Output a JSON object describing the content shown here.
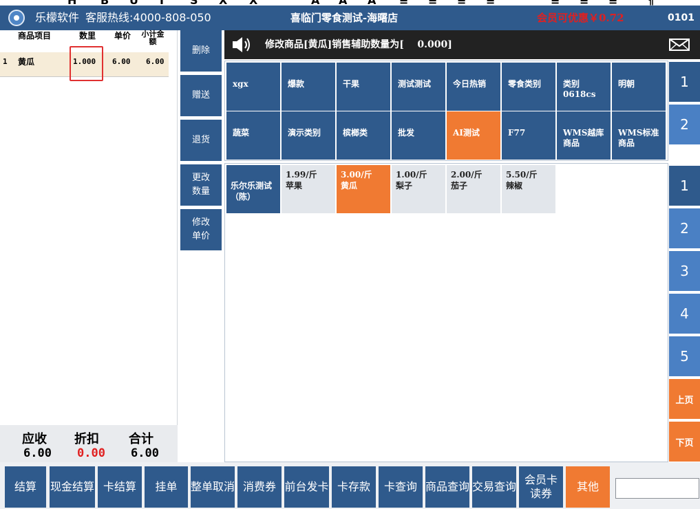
{
  "toolbar_fragment": [
    "H",
    "B",
    "U",
    "I",
    "S",
    "X",
    "X",
    "A",
    "A",
    "A",
    "≡",
    "≡",
    "≡",
    "≡",
    "≡",
    "≡",
    "≡",
    "¶"
  ],
  "app": {
    "brand": "乐檬软件",
    "hotline": "客服热线:4000-808-050",
    "store_title": "喜临门零食测试-海曙店",
    "member_discount": "会员可优惠￥0.72",
    "terminal_no": "0101"
  },
  "order": {
    "headers": {
      "item": "商品项目",
      "qty": "数里",
      "price": "单价",
      "subtotal": "小计金额"
    },
    "rows": [
      {
        "index": "1",
        "name": "黄瓜",
        "qty": "1.000",
        "price": "6.00",
        "subtotal": "6.00"
      }
    ],
    "totals": {
      "receivable_label": "应收",
      "receivable": "6.00",
      "discount_label": "折扣",
      "discount": "0.00",
      "total_label": "合计",
      "total": "6.00"
    }
  },
  "actions": [
    "删除",
    "赠送",
    "退货",
    "更改\n数量",
    "修改\n单价"
  ],
  "message": "修改商品[黄瓜]销售辅助数量为[    0.000]",
  "categories": [
    "xgx",
    "爆款",
    "干果",
    "测试测试",
    "今日热销",
    "零食类别",
    "类别0618cs",
    "明朝",
    "蔬菜",
    "演示类别",
    "槟榔类",
    "批发",
    "AI测试",
    "F77",
    "WMS越库商品",
    "WMS标准商品"
  ],
  "selected_category": "AI测试",
  "supplier": "乐尔乐测试（陈）",
  "products": [
    {
      "price": "1.99/斤",
      "name": "苹果"
    },
    {
      "price": "3.00/斤",
      "name": "黄瓜"
    },
    {
      "price": "1.00/斤",
      "name": "梨子"
    },
    {
      "price": "2.00/斤",
      "name": "茄子"
    },
    {
      "price": "5.50/斤",
      "name": "辣椒"
    }
  ],
  "selected_product": "黄瓜",
  "category_pages": [
    "1",
    "2"
  ],
  "product_pages": [
    "1",
    "2",
    "3",
    "4",
    "5"
  ],
  "prev_page": "上页",
  "next_page": "下页",
  "bottom_buttons": [
    "结算",
    "现金结算",
    "卡结算",
    "挂单",
    "整单取消",
    "消费券",
    "前台发卡",
    "卡存款",
    "卡查询",
    "商品查询",
    "交易查询",
    "会员卡\n读券",
    "其他"
  ],
  "colors": {
    "primary": "#2f5a8c",
    "accent": "#f07a32",
    "alert": "#e02020"
  }
}
